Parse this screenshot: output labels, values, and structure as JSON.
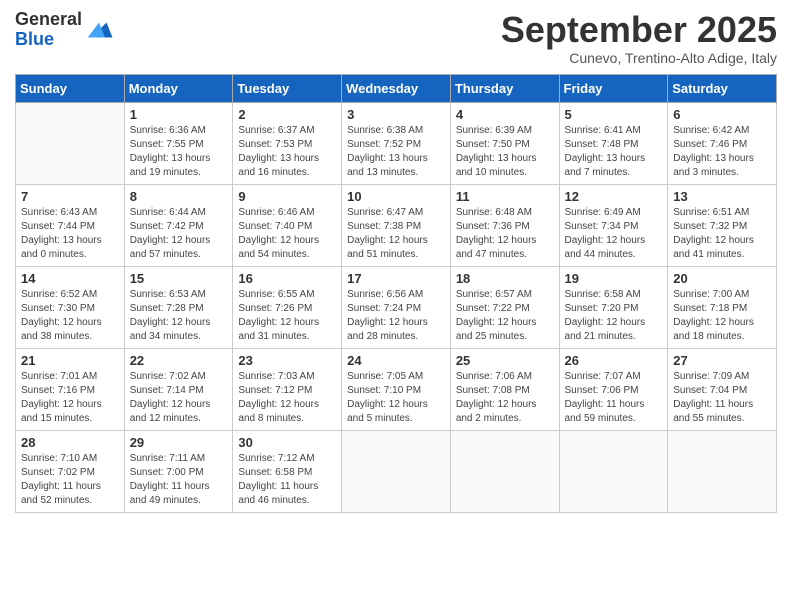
{
  "header": {
    "logo_line1": "General",
    "logo_line2": "Blue",
    "month": "September 2025",
    "location": "Cunevo, Trentino-Alto Adige, Italy"
  },
  "days_of_week": [
    "Sunday",
    "Monday",
    "Tuesday",
    "Wednesday",
    "Thursday",
    "Friday",
    "Saturday"
  ],
  "weeks": [
    [
      {
        "day": "",
        "info": ""
      },
      {
        "day": "1",
        "info": "Sunrise: 6:36 AM\nSunset: 7:55 PM\nDaylight: 13 hours\nand 19 minutes."
      },
      {
        "day": "2",
        "info": "Sunrise: 6:37 AM\nSunset: 7:53 PM\nDaylight: 13 hours\nand 16 minutes."
      },
      {
        "day": "3",
        "info": "Sunrise: 6:38 AM\nSunset: 7:52 PM\nDaylight: 13 hours\nand 13 minutes."
      },
      {
        "day": "4",
        "info": "Sunrise: 6:39 AM\nSunset: 7:50 PM\nDaylight: 13 hours\nand 10 minutes."
      },
      {
        "day": "5",
        "info": "Sunrise: 6:41 AM\nSunset: 7:48 PM\nDaylight: 13 hours\nand 7 minutes."
      },
      {
        "day": "6",
        "info": "Sunrise: 6:42 AM\nSunset: 7:46 PM\nDaylight: 13 hours\nand 3 minutes."
      }
    ],
    [
      {
        "day": "7",
        "info": "Sunrise: 6:43 AM\nSunset: 7:44 PM\nDaylight: 13 hours\nand 0 minutes."
      },
      {
        "day": "8",
        "info": "Sunrise: 6:44 AM\nSunset: 7:42 PM\nDaylight: 12 hours\nand 57 minutes."
      },
      {
        "day": "9",
        "info": "Sunrise: 6:46 AM\nSunset: 7:40 PM\nDaylight: 12 hours\nand 54 minutes."
      },
      {
        "day": "10",
        "info": "Sunrise: 6:47 AM\nSunset: 7:38 PM\nDaylight: 12 hours\nand 51 minutes."
      },
      {
        "day": "11",
        "info": "Sunrise: 6:48 AM\nSunset: 7:36 PM\nDaylight: 12 hours\nand 47 minutes."
      },
      {
        "day": "12",
        "info": "Sunrise: 6:49 AM\nSunset: 7:34 PM\nDaylight: 12 hours\nand 44 minutes."
      },
      {
        "day": "13",
        "info": "Sunrise: 6:51 AM\nSunset: 7:32 PM\nDaylight: 12 hours\nand 41 minutes."
      }
    ],
    [
      {
        "day": "14",
        "info": "Sunrise: 6:52 AM\nSunset: 7:30 PM\nDaylight: 12 hours\nand 38 minutes."
      },
      {
        "day": "15",
        "info": "Sunrise: 6:53 AM\nSunset: 7:28 PM\nDaylight: 12 hours\nand 34 minutes."
      },
      {
        "day": "16",
        "info": "Sunrise: 6:55 AM\nSunset: 7:26 PM\nDaylight: 12 hours\nand 31 minutes."
      },
      {
        "day": "17",
        "info": "Sunrise: 6:56 AM\nSunset: 7:24 PM\nDaylight: 12 hours\nand 28 minutes."
      },
      {
        "day": "18",
        "info": "Sunrise: 6:57 AM\nSunset: 7:22 PM\nDaylight: 12 hours\nand 25 minutes."
      },
      {
        "day": "19",
        "info": "Sunrise: 6:58 AM\nSunset: 7:20 PM\nDaylight: 12 hours\nand 21 minutes."
      },
      {
        "day": "20",
        "info": "Sunrise: 7:00 AM\nSunset: 7:18 PM\nDaylight: 12 hours\nand 18 minutes."
      }
    ],
    [
      {
        "day": "21",
        "info": "Sunrise: 7:01 AM\nSunset: 7:16 PM\nDaylight: 12 hours\nand 15 minutes."
      },
      {
        "day": "22",
        "info": "Sunrise: 7:02 AM\nSunset: 7:14 PM\nDaylight: 12 hours\nand 12 minutes."
      },
      {
        "day": "23",
        "info": "Sunrise: 7:03 AM\nSunset: 7:12 PM\nDaylight: 12 hours\nand 8 minutes."
      },
      {
        "day": "24",
        "info": "Sunrise: 7:05 AM\nSunset: 7:10 PM\nDaylight: 12 hours\nand 5 minutes."
      },
      {
        "day": "25",
        "info": "Sunrise: 7:06 AM\nSunset: 7:08 PM\nDaylight: 12 hours\nand 2 minutes."
      },
      {
        "day": "26",
        "info": "Sunrise: 7:07 AM\nSunset: 7:06 PM\nDaylight: 11 hours\nand 59 minutes."
      },
      {
        "day": "27",
        "info": "Sunrise: 7:09 AM\nSunset: 7:04 PM\nDaylight: 11 hours\nand 55 minutes."
      }
    ],
    [
      {
        "day": "28",
        "info": "Sunrise: 7:10 AM\nSunset: 7:02 PM\nDaylight: 11 hours\nand 52 minutes."
      },
      {
        "day": "29",
        "info": "Sunrise: 7:11 AM\nSunset: 7:00 PM\nDaylight: 11 hours\nand 49 minutes."
      },
      {
        "day": "30",
        "info": "Sunrise: 7:12 AM\nSunset: 6:58 PM\nDaylight: 11 hours\nand 46 minutes."
      },
      {
        "day": "",
        "info": ""
      },
      {
        "day": "",
        "info": ""
      },
      {
        "day": "",
        "info": ""
      },
      {
        "day": "",
        "info": ""
      }
    ]
  ]
}
